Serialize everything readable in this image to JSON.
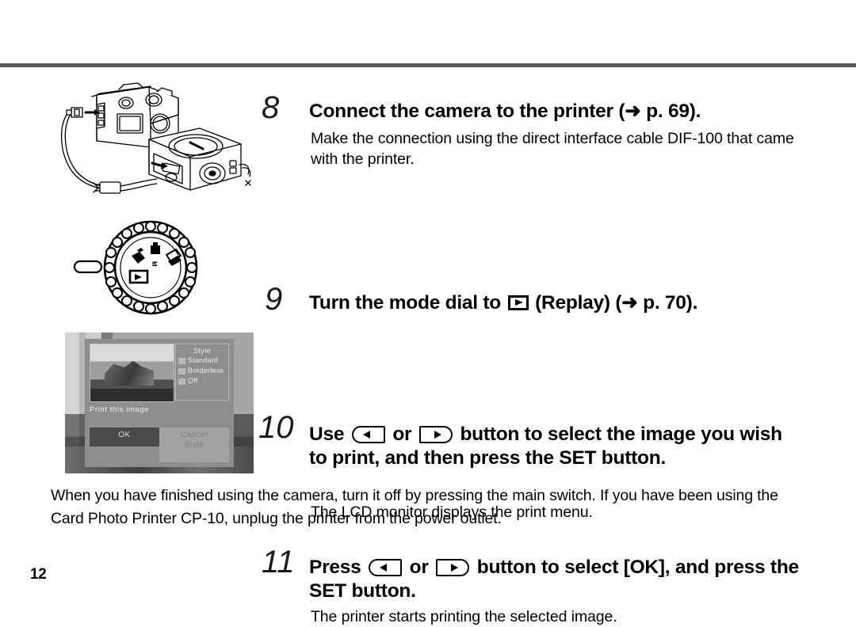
{
  "page": {
    "number": "12"
  },
  "steps": [
    {
      "number": "8",
      "title_pre": "Connect the camera to the printer (",
      "title_post": " p. 69).",
      "arrow": "➜",
      "body": "Make the connection using the direct interface cable DIF-100 that came with the printer."
    },
    {
      "number": "9",
      "title_pre": "Turn the mode dial to ",
      "title_mid": " (Replay) (",
      "title_post": " p. 70).",
      "arrow": "➜",
      "body": ""
    },
    {
      "number": "10",
      "title_pre": "Use ",
      "title_mid": " or ",
      "title_post": " button to select the image you wish to print, and then press the SET button.",
      "body": "The LCD monitor displays the print menu."
    },
    {
      "number": "11",
      "title_pre": "Press ",
      "title_mid": " or ",
      "title_post": " button to select [OK], and press the SET button.",
      "body": "The printer starts printing the selected image."
    }
  ],
  "closing_paragraph": "When you have finished using the camera, turn it off by pressing the main switch. If you have been using the Card Photo Printer CP-10, unplug the printer from the power outlet.",
  "lcd_screen": {
    "menu_title": "Style",
    "options": [
      {
        "label": "Standard"
      },
      {
        "label": "Borderless"
      },
      {
        "label": "Off"
      }
    ],
    "caption": "Print this image",
    "buttons": {
      "ok": "OK",
      "cancel": "Cancel",
      "style": "Style"
    }
  },
  "colors": {
    "rule": "#595959",
    "text": "#000000",
    "lcd_background": "#8e8e8e",
    "lcd_selected": "#4a4a4a"
  }
}
